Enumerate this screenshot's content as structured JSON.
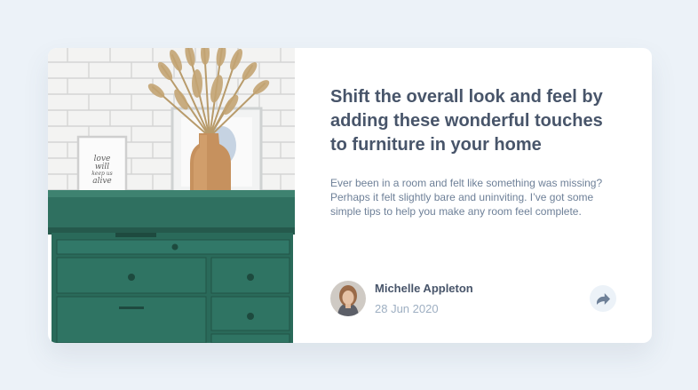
{
  "article": {
    "title": "Shift the overall look and feel by adding these wonderful touches to furniture in your home",
    "description": "Ever been in a room and felt like something was missing? Perhaps it felt slightly bare and uninviting. I’ve got some simple tips to help you make any room feel complete.",
    "image_frame_text": [
      "love",
      "will",
      "keep us",
      "alive"
    ]
  },
  "author": {
    "name": "Michelle Appleton",
    "date": "28 Jun 2020"
  },
  "icons": {
    "share": "share-arrow-icon",
    "avatar": "author-avatar"
  },
  "colors": {
    "page_background": "#ecf2f8",
    "title": "#48556a",
    "body_text": "#6e8098",
    "muted": "#9eafc2",
    "share_button_bg": "#ecf2f8",
    "share_icon": "#6e8098"
  }
}
